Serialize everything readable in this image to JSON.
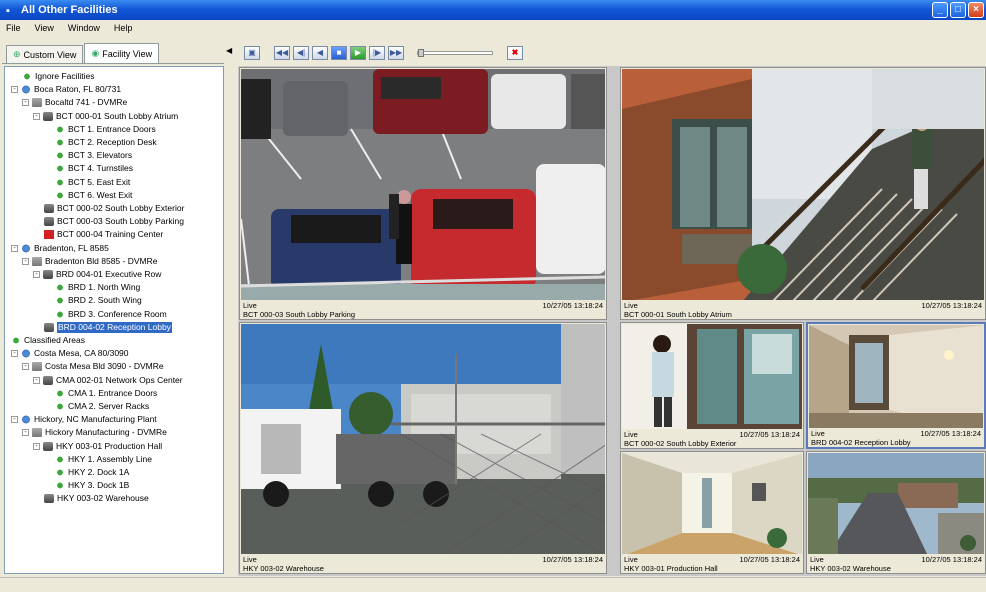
{
  "window": {
    "title": "All Other Facilities"
  },
  "menu": [
    "File",
    "View",
    "Window",
    "Help"
  ],
  "tabs": [
    {
      "label": "Custom View"
    },
    {
      "label": "Facility View"
    }
  ],
  "tree": [
    {
      "label": "Ignore Facilities",
      "icon": "green",
      "level": 1,
      "expander": ""
    },
    {
      "label": "Boca Raton, FL 80/731",
      "icon": "globe",
      "level": 0,
      "expander": "-"
    },
    {
      "label": "Bocaltd 741 - DVMRe",
      "icon": "bld",
      "level": 1,
      "expander": "-"
    },
    {
      "label": "BCT 000-01 South Lobby Atrium",
      "icon": "cam",
      "level": 2,
      "expander": "-"
    },
    {
      "label": "BCT 1. Entrance Doors",
      "icon": "green",
      "level": 4,
      "expander": ""
    },
    {
      "label": "BCT 2. Reception Desk",
      "icon": "green",
      "level": 4,
      "expander": ""
    },
    {
      "label": "BCT 3. Elevators",
      "icon": "green",
      "level": 4,
      "expander": ""
    },
    {
      "label": "BCT 4. Turnstiles",
      "icon": "green",
      "level": 4,
      "expander": ""
    },
    {
      "label": "BCT 5. East Exit",
      "icon": "green",
      "level": 4,
      "expander": ""
    },
    {
      "label": "BCT 6. West Exit",
      "icon": "green",
      "level": 4,
      "expander": ""
    },
    {
      "label": "BCT 000-02 South Lobby Exterior",
      "icon": "cam",
      "level": 3,
      "expander": ""
    },
    {
      "label": "BCT 000-03 South Lobby Parking",
      "icon": "cam",
      "level": 3,
      "expander": ""
    },
    {
      "label": "BCT 000-04 Training Center",
      "icon": "red",
      "level": 3,
      "expander": ""
    },
    {
      "label": "Bradenton, FL 8585",
      "icon": "globe",
      "level": 0,
      "expander": "-"
    },
    {
      "label": "Bradenton Bld 8585 - DVMRe",
      "icon": "bld",
      "level": 1,
      "expander": "-"
    },
    {
      "label": "BRD 004-01 Executive Row",
      "icon": "cam",
      "level": 2,
      "expander": "-"
    },
    {
      "label": "BRD 1. North Wing",
      "icon": "green",
      "level": 4,
      "expander": ""
    },
    {
      "label": "BRD 2. South Wing",
      "icon": "green",
      "level": 4,
      "expander": ""
    },
    {
      "label": "BRD 3. Conference Room",
      "icon": "green",
      "level": 4,
      "expander": ""
    },
    {
      "label": "BRD 004-02 Reception Lobby",
      "icon": "cam",
      "level": 3,
      "expander": "",
      "selected": true
    },
    {
      "label": "Classified Areas",
      "icon": "green",
      "level": 0,
      "expander": ""
    },
    {
      "label": "Costa Mesa, CA 80/3090",
      "icon": "globe",
      "level": 0,
      "expander": "-"
    },
    {
      "label": "Costa Mesa Bld 3090 - DVMRe",
      "icon": "bld",
      "level": 1,
      "expander": "-"
    },
    {
      "label": "CMA 002-01 Network Ops Center",
      "icon": "cam",
      "level": 2,
      "expander": "-"
    },
    {
      "label": "CMA 1. Entrance Doors",
      "icon": "green",
      "level": 4,
      "expander": ""
    },
    {
      "label": "CMA 2. Server Racks",
      "icon": "green",
      "level": 4,
      "expander": ""
    },
    {
      "label": "Hickory, NC Manufacturing Plant",
      "icon": "globe",
      "level": 0,
      "expander": "-"
    },
    {
      "label": "Hickory Manufacturing - DVMRe",
      "icon": "bld",
      "level": 1,
      "expander": "-"
    },
    {
      "label": "HKY 003-01 Production Hall",
      "icon": "cam",
      "level": 2,
      "expander": "-"
    },
    {
      "label": "HKY 1. Assembly Line",
      "icon": "green",
      "level": 4,
      "expander": ""
    },
    {
      "label": "HKY 2. Dock 1A",
      "icon": "green",
      "level": 4,
      "expander": ""
    },
    {
      "label": "HKY 3. Dock 1B",
      "icon": "green",
      "level": 4,
      "expander": ""
    },
    {
      "label": "HKY 003-02 Warehouse",
      "icon": "cam",
      "level": 3,
      "expander": ""
    }
  ],
  "toolbar": {
    "buttons": [
      {
        "name": "snapshot-button",
        "glyph": "▣",
        "style": ""
      },
      {
        "name": "rewind-fast-button",
        "glyph": "◀◀",
        "style": ""
      },
      {
        "name": "step-back-button",
        "glyph": "◀|",
        "style": ""
      },
      {
        "name": "play-reverse-button",
        "glyph": "◀",
        "style": ""
      },
      {
        "name": "stop-button",
        "glyph": "■",
        "style": "blue"
      },
      {
        "name": "play-button",
        "glyph": "▶",
        "style": "green"
      },
      {
        "name": "step-forward-button",
        "glyph": "|▶",
        "style": ""
      },
      {
        "name": "forward-fast-button",
        "glyph": "▶▶",
        "style": ""
      }
    ],
    "close_glyph": "✖"
  },
  "feeds": [
    {
      "id": "parking",
      "status": "Live",
      "time": "10/27/05 13:18:24",
      "camera": "BCT 000-03 South Lobby Parking"
    },
    {
      "id": "atrium",
      "status": "Live",
      "time": "10/27/05 13:18:24",
      "camera": "BCT 000-01 South Lobby Atrium"
    },
    {
      "id": "warehouse",
      "status": "Live",
      "time": "10/27/05 13:18:24",
      "camera": "HKY 003-02 Warehouse"
    },
    {
      "id": "exterior",
      "status": "Live",
      "time": "10/27/05 13:18:24",
      "camera": "BCT 000-02 South Lobby Exterior"
    },
    {
      "id": "reception",
      "status": "Live",
      "time": "10/27/05 13:18:24",
      "camera": "BRD 004-02 Reception Lobby"
    },
    {
      "id": "production",
      "status": "Live",
      "time": "10/27/05 13:18:24",
      "camera": "HKY 003-01 Production Hall"
    },
    {
      "id": "plant",
      "status": "Live",
      "time": "10/27/05 13:18:24",
      "camera": "HKY 003-02 Warehouse"
    }
  ],
  "colors": {
    "titlebar": "#1257d6",
    "selection": "#316ac5",
    "alarm": "#d42020"
  }
}
